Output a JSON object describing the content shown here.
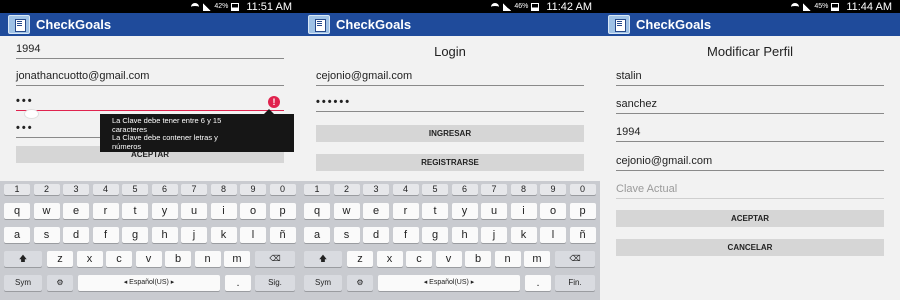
{
  "phones": [
    {
      "status": {
        "battery": "42%",
        "time": "11:51 AM"
      },
      "app_title": "CheckGoals",
      "fields": [
        "1994",
        "jonathancuotto@gmail.com",
        "•••",
        "•••"
      ],
      "error_glyph": "!",
      "tooltip": [
        "La Clave debe tener entre 6 y 15",
        "caracteres",
        "La Clave debe contener letras y",
        "números"
      ],
      "buttons": [
        "ACEPTAR"
      ],
      "keyboard": {
        "enter": "Sig."
      }
    },
    {
      "status": {
        "battery": "46%",
        "time": "11:42 AM"
      },
      "app_title": "CheckGoals",
      "heading": "Login",
      "fields": [
        "cejonio@gmail.com",
        "••••••"
      ],
      "buttons": [
        "INGRESAR",
        "REGISTRARSE"
      ],
      "keyboard": {
        "enter": "Fin."
      }
    },
    {
      "status": {
        "battery": "45%",
        "time": "11:44 AM"
      },
      "app_title": "CheckGoals",
      "heading": "Modificar Perfil",
      "fields": [
        "stalin",
        "sanchez",
        "1994",
        "cejonio@gmail.com"
      ],
      "placeholder": "Clave Actual",
      "buttons": [
        "ACEPTAR",
        "CANCELAR"
      ]
    }
  ],
  "keyboard": {
    "numbers": [
      "1",
      "2",
      "3",
      "4",
      "5",
      "6",
      "7",
      "8",
      "9",
      "0"
    ],
    "row1": [
      "q",
      "w",
      "e",
      "r",
      "t",
      "y",
      "u",
      "i",
      "o",
      "p"
    ],
    "row2": [
      "a",
      "s",
      "d",
      "f",
      "g",
      "h",
      "j",
      "k",
      "l",
      "ñ"
    ],
    "row3": [
      "z",
      "x",
      "c",
      "v",
      "b",
      "n",
      "m"
    ],
    "shift_glyph": "🡅",
    "backspace_glyph": "⌫",
    "sym": "Sym",
    "space": "◂ Español(US) ▸",
    "period": ".",
    "settings_glyph": "⚙"
  }
}
